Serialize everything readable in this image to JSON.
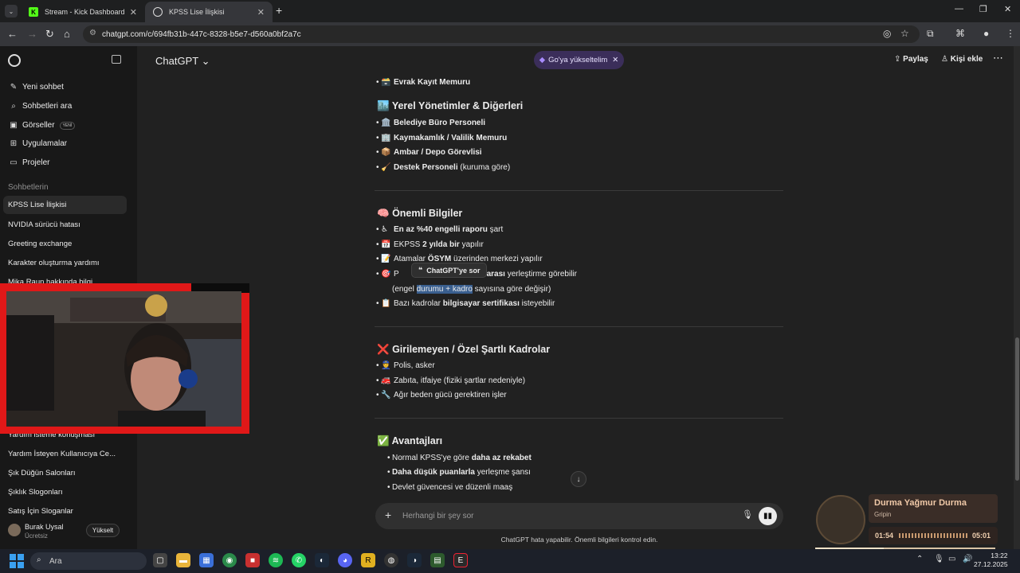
{
  "browser": {
    "tabs": [
      {
        "title": "Stream - Kick Dashboard",
        "favicon": "K"
      },
      {
        "title": "KPSS Lise İlişkisi",
        "favicon": "chatgpt-icon"
      }
    ],
    "url": "chatgpt.com/c/694fb31b-447c-8328-b5e7-d560a0bf2a7c"
  },
  "sidebar": {
    "nav": [
      {
        "label": "Yeni sohbet",
        "icon": "new-chat-icon"
      },
      {
        "label": "Sohbetleri ara",
        "icon": "search-icon"
      },
      {
        "label": "Görseller",
        "icon": "images-icon",
        "badge": "YENİ"
      },
      {
        "label": "Uygulamalar",
        "icon": "apps-icon"
      },
      {
        "label": "Projeler",
        "icon": "folder-icon"
      }
    ],
    "section_title": "Sohbetlerin",
    "chats": [
      "KPSS Lise İlişkisi",
      "NVIDIA sürücü hatası",
      "Greeting exchange",
      "Karakter oluşturma yardımı",
      "Mika Raun hakkında bilgi",
      "Yardım isteme konuşması",
      "Yardım İsteyen Kullanıcıya Ce...",
      "Şık Düğün Salonları",
      "Şıklık Slogonları",
      "Satış İçin Sloganlar"
    ],
    "user": {
      "name": "Burak Uysal",
      "plan": "Ücretsiz",
      "upgrade": "Yükselt"
    }
  },
  "header": {
    "model": "ChatGPT",
    "upgrade_pill": "Go'ya yükseltelim",
    "share": "Paylaş",
    "add_person": "Kişi ekle"
  },
  "content": {
    "top_item": {
      "emoji": "🗃️",
      "text": "Evrak Kayıt Memuru"
    },
    "section1": {
      "title": "Yerel Yönetimler & Diğerleri",
      "emoji": "🏙️",
      "items": [
        {
          "emoji": "🏛️",
          "bold": "Belediye Büro Personeli",
          "rest": ""
        },
        {
          "emoji": "🏢",
          "bold": "Kaymakamlık / Valilik Memuru",
          "rest": ""
        },
        {
          "emoji": "📦",
          "bold": "Ambar / Depo Görevlisi",
          "rest": ""
        },
        {
          "emoji": "🧹",
          "bold": "Destek Personeli",
          "rest": " (kuruma göre)"
        }
      ]
    },
    "section2": {
      "title": "Önemli Bilgiler",
      "emoji": "🧠",
      "item1": {
        "emoji": "♿",
        "bold": "En az %40 engelli raporu",
        "rest": " şart"
      },
      "item2": {
        "emoji": "📅",
        "pre": "EKPSS ",
        "bold": "2 yılda bir",
        "rest": " yapılır"
      },
      "item3": {
        "emoji": "📝",
        "pre": "Atamalar ",
        "bold": "ÖSYM",
        "rest": " üzerinden merkezi yapılır"
      },
      "item4": {
        "emoji": "🎯",
        "pre": "P",
        "bold": "35 arası",
        "rest": " yerleştirme görebilir"
      },
      "item4_line2": {
        "pre": "(engel ",
        "selected": "durumu + kadro",
        "rest": " sayısına göre değişir)"
      },
      "item5": {
        "emoji": "📋",
        "pre": "Bazı kadrolar ",
        "bold": "bilgisayar sertifikası",
        "rest": " isteyebilir"
      }
    },
    "tooltip": "ChatGPT'ye sor",
    "section3": {
      "title": "Girilemeyen / Özel Şartlı Kadrolar",
      "emoji": "❌",
      "items": [
        {
          "emoji": "👮",
          "text": "Polis, asker"
        },
        {
          "emoji": "🚒",
          "text": "Zabıta, itfaiye (fiziki şartlar nedeniyle)"
        },
        {
          "emoji": "🔧",
          "text": "Ağır beden gücü gerektiren işler"
        }
      ]
    },
    "section4": {
      "title": "Avantajları",
      "emoji": "✅",
      "item1": {
        "pre": "Normal KPSS'ye göre ",
        "bold": "daha az rekabet",
        "rest": ""
      },
      "item2": {
        "pre": "",
        "bold": "Daha düşük puanlarla",
        "rest": " yerleşme şansı"
      },
      "item3": {
        "pre": "Devlet güvencesi ve düzenli maaş",
        "bold": "",
        "rest": ""
      }
    }
  },
  "composer": {
    "placeholder": "Herhangi bir şey sor",
    "disclaimer": "ChatGPT hata yapabilir. Önemli bilgileri kontrol edin."
  },
  "music": {
    "title": "Durma Yağmur Durma",
    "artist": "Gripin",
    "elapsed": "01:54",
    "total": "05:01",
    "progress_fraction": 0.38
  },
  "taskbar": {
    "search": "Ara",
    "time": "13:22",
    "date": "27.12.2025"
  }
}
